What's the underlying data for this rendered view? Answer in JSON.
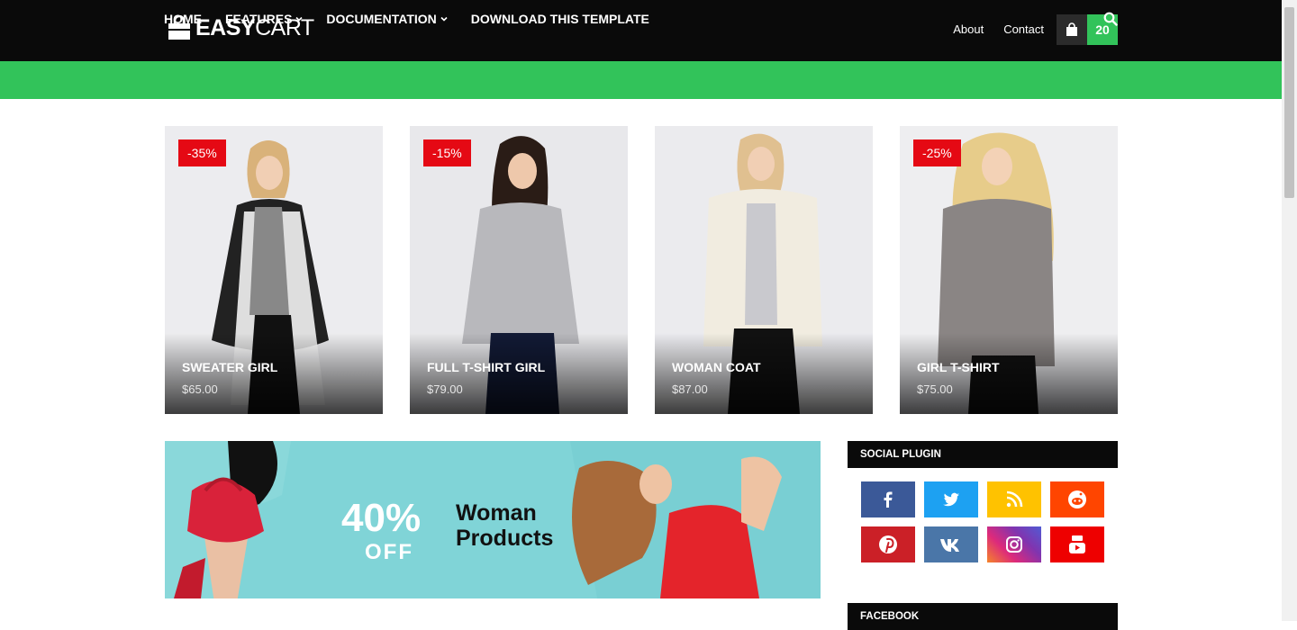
{
  "header": {
    "logo_text_bold": "EASY",
    "logo_text_light": "CART",
    "links": [
      "About",
      "Contact"
    ],
    "cart_count": "20"
  },
  "nav": {
    "items": [
      "HOME",
      "FEATURES",
      "DOCUMENTATION",
      "DOWNLOAD THIS TEMPLATE"
    ]
  },
  "products": [
    {
      "badge": "-35%",
      "name": "SWEATER GIRL",
      "price": "$65.00"
    },
    {
      "badge": "-15%",
      "name": "FULL T-SHIRT GIRL",
      "price": "$79.00"
    },
    {
      "badge": "",
      "name": "WOMAN COAT",
      "price": "$87.00"
    },
    {
      "badge": "-25%",
      "name": "GIRL T-SHIRT",
      "price": "$75.00"
    }
  ],
  "banner": {
    "percent": "40%",
    "off": "OFF",
    "line1": "Woman",
    "line2": "Products"
  },
  "sidebar": {
    "social_title": "SOCIAL PLUGIN",
    "facebook_title": "FACEBOOK",
    "social_icons": [
      "facebook-icon",
      "twitter-icon",
      "rss-icon",
      "reddit-icon",
      "pinterest-icon",
      "vk-icon",
      "instagram-icon",
      "youtube-icon"
    ]
  },
  "colors": {
    "accent": "#32c35a",
    "badge": "#e50914",
    "topbar": "#0a0a0a"
  }
}
